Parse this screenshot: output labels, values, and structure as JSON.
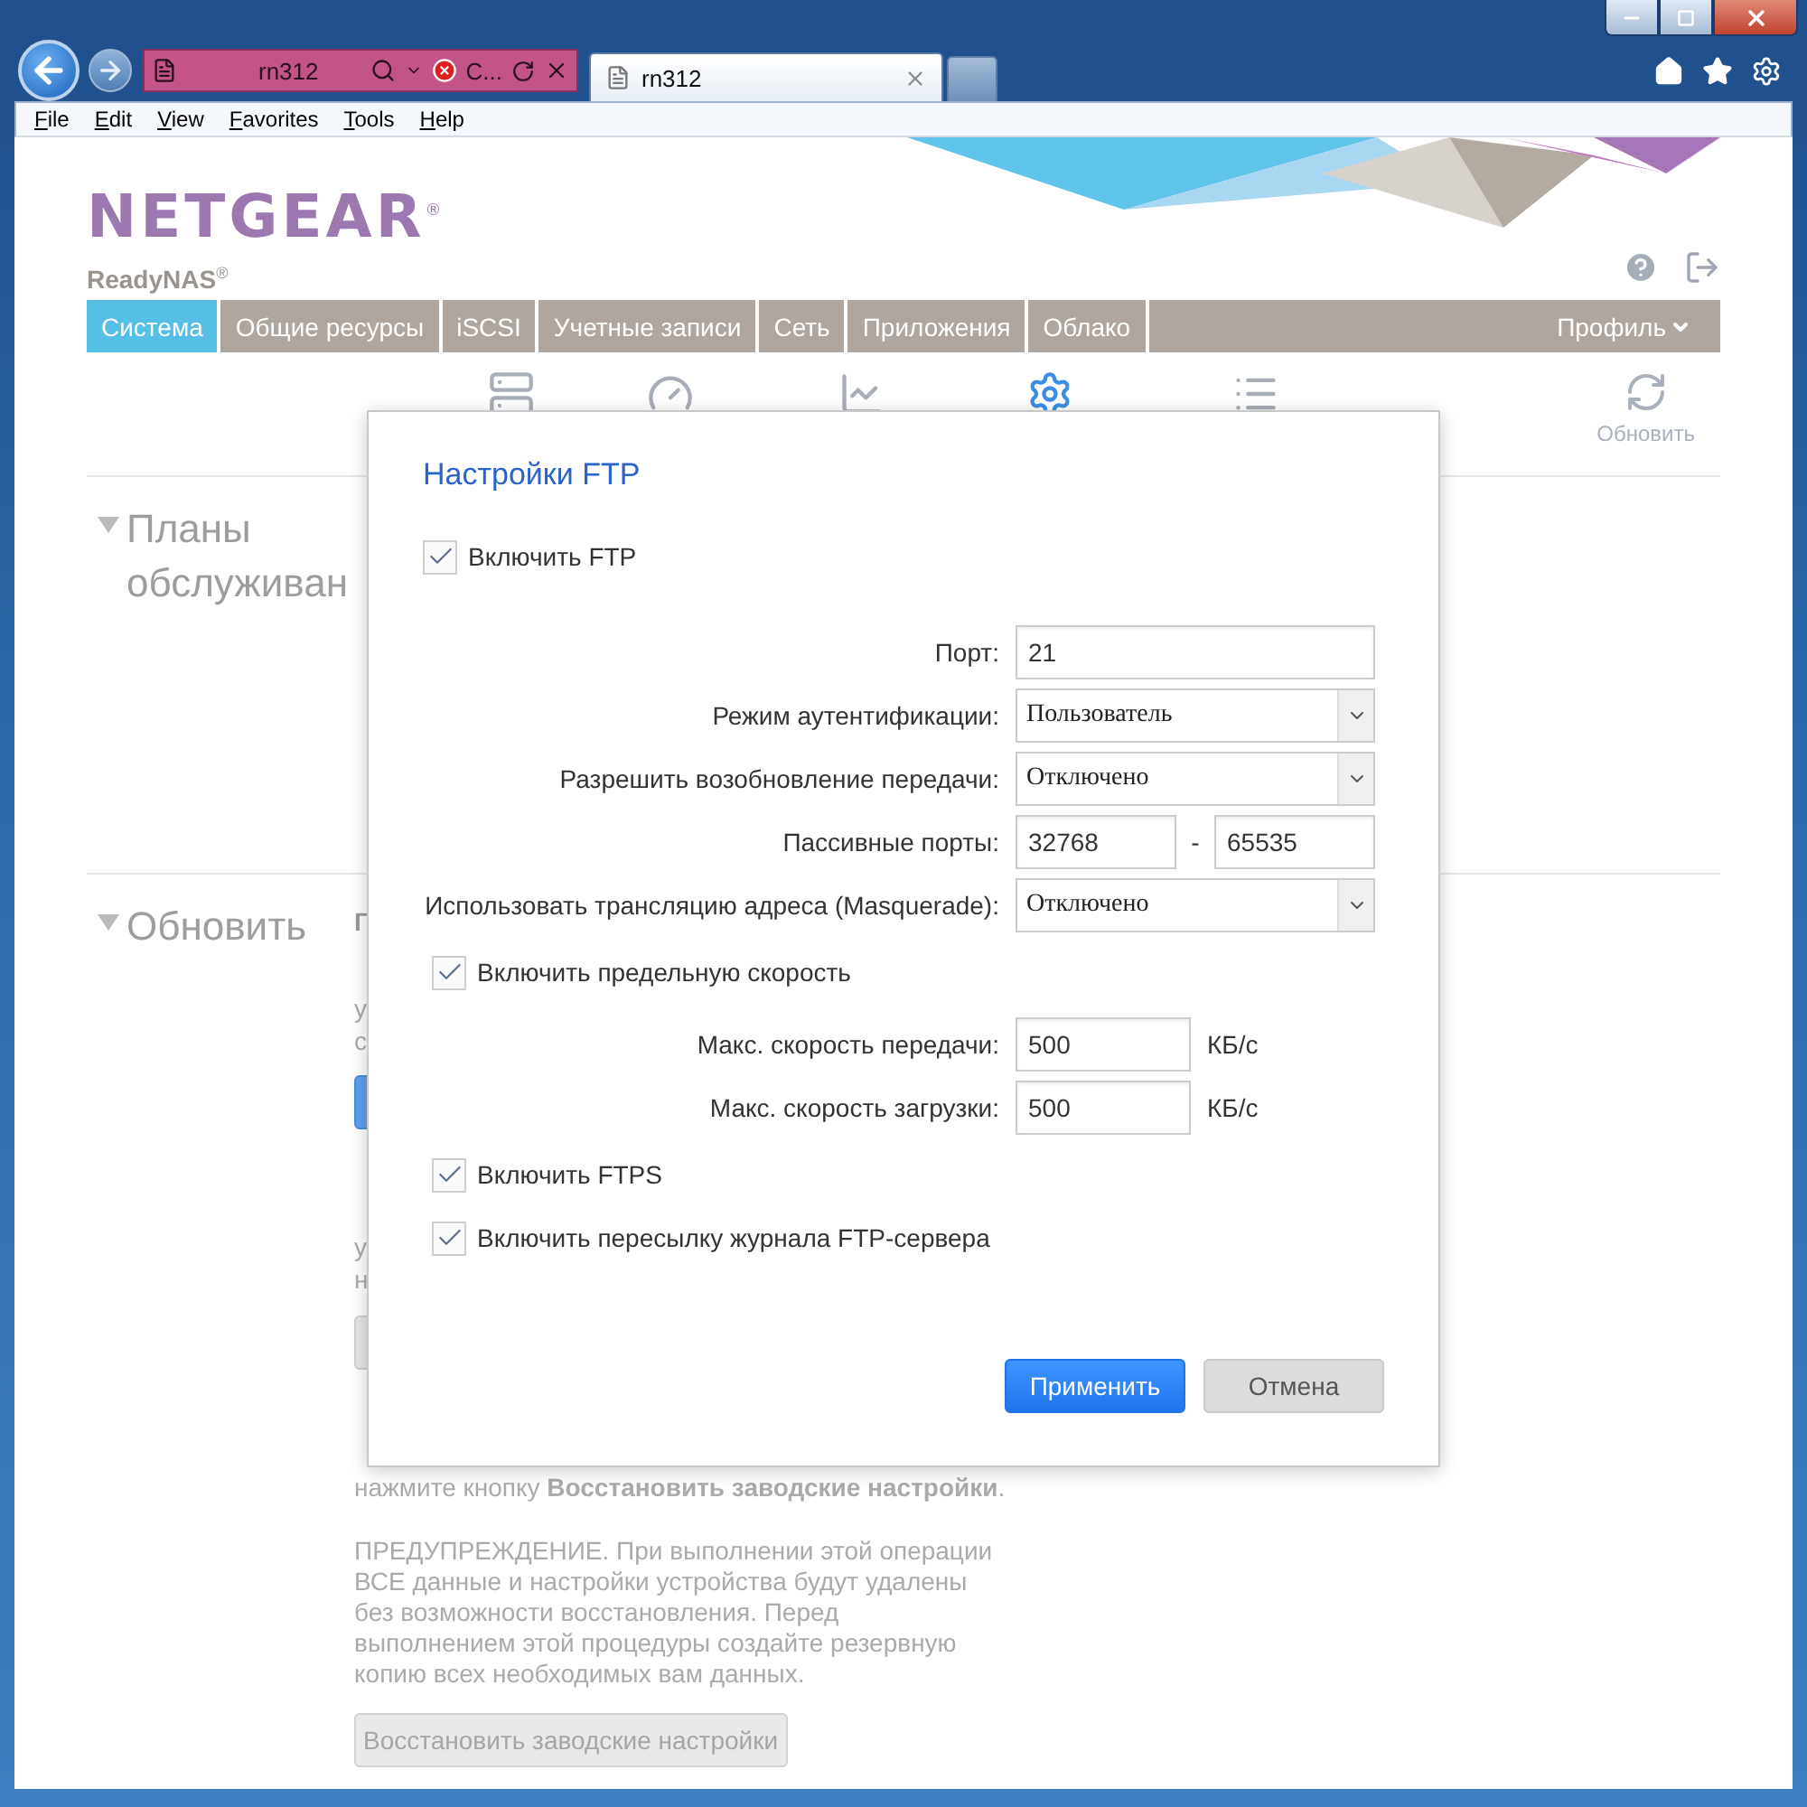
{
  "browser": {
    "address": "rn312",
    "address_status": "C...",
    "tabs": [
      {
        "title": "rn312",
        "selected": true
      }
    ],
    "menu": [
      "File",
      "Edit",
      "View",
      "Favorites",
      "Tools",
      "Help"
    ]
  },
  "app": {
    "logo": "NETGEAR",
    "logo_mark": "®",
    "product": "ReadyNAS",
    "product_mark": "®",
    "nav": [
      {
        "label": "Система",
        "selected": true
      },
      {
        "label": "Общие ресурсы",
        "selected": false
      },
      {
        "label": "iSCSI",
        "selected": false
      },
      {
        "label": "Учетные записи",
        "selected": false
      },
      {
        "label": "Сеть",
        "selected": false
      },
      {
        "label": "Приложения",
        "selected": false
      },
      {
        "label": "Облако",
        "selected": false
      }
    ],
    "profile": "Профиль",
    "refresh_label": "Обновить"
  },
  "maintenance": {
    "title": "Планы обслуживан"
  },
  "update": {
    "title": "Обновить",
    "fragments": [
      {
        "kind": "heading",
        "text": "Г"
      },
      {
        "kind": "line",
        "text": "у"
      },
      {
        "kind": "line",
        "text": "с"
      },
      {
        "kind": "primary-button"
      },
      {
        "kind": "line",
        "text": "у"
      },
      {
        "kind": "line",
        "text": "н"
      },
      {
        "kind": "button"
      }
    ],
    "reset_text": "нажмите кнопку **Восстановить заводские настройки**.",
    "warning": "ПРЕДУПРЕЖДЕНИЕ. При выполнении этой операции ВСЕ данные и настройки устройства будут удалены без возможности восстановления. Перед выполнением этой процедуры создайте резервную копию всех необходимых вам данных.",
    "reset_button": "Восстановить заводские настройки"
  },
  "dialog": {
    "title": "Настройки FTP",
    "enable": {
      "label": "Включить FTP",
      "checked": true
    },
    "fields": [
      {
        "kind": "text",
        "label": "Порт:",
        "value": "21"
      },
      {
        "kind": "select",
        "label": "Режим аутентификации:",
        "value": "Пользователь"
      },
      {
        "kind": "select",
        "label": "Разрешить возобновление передачи:",
        "value": "Отключено"
      },
      {
        "kind": "range",
        "label": "Пассивные порты:",
        "from": "32768",
        "separator": "-",
        "to": "65535"
      },
      {
        "kind": "select",
        "label": "Использовать трансляцию адреса (Masquerade):",
        "value": "Отключено"
      }
    ],
    "limit": {
      "label": "Включить предельную скорость",
      "checked": true
    },
    "speeds": [
      {
        "label": "Макс. скорость передачи:",
        "value": "500",
        "unit": "КБ/с"
      },
      {
        "label": "Макс. скорость загрузки:",
        "value": "500",
        "unit": "КБ/с"
      }
    ],
    "options": [
      {
        "label": "Включить FTPS",
        "checked": true
      },
      {
        "label": "Включить пересылку журнала FTP-сервера",
        "checked": true
      }
    ],
    "buttons": [
      {
        "label": "Применить",
        "kind": "primary"
      },
      {
        "label": "Отмена",
        "kind": "secondary"
      }
    ]
  }
}
